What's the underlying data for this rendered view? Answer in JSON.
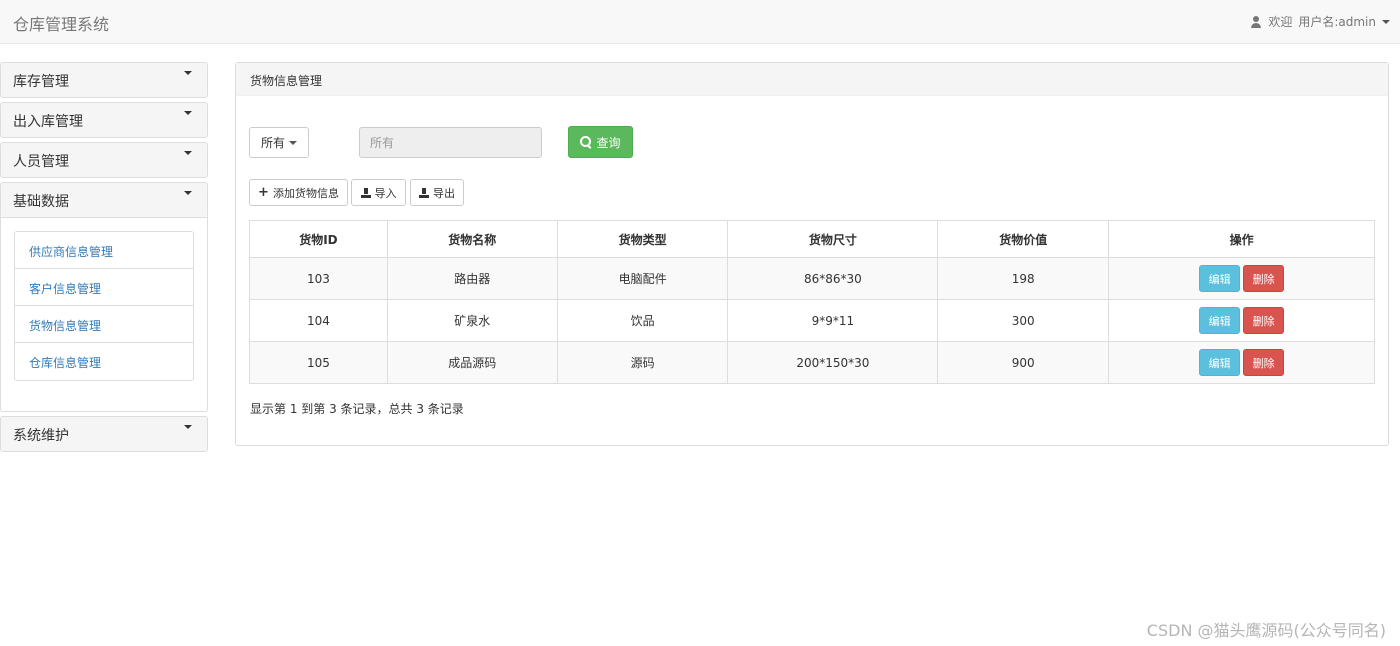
{
  "navbar": {
    "brand": "仓库管理系统",
    "welcome": "欢迎",
    "username": "用户名:admin"
  },
  "sidebar": {
    "menus": [
      {
        "label": "库存管理"
      },
      {
        "label": "出入库管理"
      },
      {
        "label": "人员管理"
      },
      {
        "label": "基础数据",
        "items": [
          "供应商信息管理",
          "客户信息管理",
          "货物信息管理",
          "仓库信息管理"
        ]
      },
      {
        "label": "系统维护"
      }
    ]
  },
  "panel": {
    "title": "货物信息管理",
    "filter_select": "所有",
    "search_placeholder": "所有",
    "query_label": "查询",
    "add_label": "添加货物信息",
    "import_label": "导入",
    "export_label": "导出"
  },
  "table": {
    "headers": [
      "货物ID",
      "货物名称",
      "货物类型",
      "货物尺寸",
      "货物价值",
      "操作"
    ],
    "rows": [
      {
        "id": "103",
        "name": "路由器",
        "type": "电脑配件",
        "size": "86*86*30",
        "value": "198"
      },
      {
        "id": "104",
        "name": "矿泉水",
        "type": "饮品",
        "size": "9*9*11",
        "value": "300"
      },
      {
        "id": "105",
        "name": "成品源码",
        "type": "源码",
        "size": "200*150*30",
        "value": "900"
      }
    ],
    "edit_label": "编辑",
    "delete_label": "删除"
  },
  "pagination": {
    "summary": "显示第 1 到第 3 条记录，总共 3 条记录"
  },
  "watermark": "CSDN @猫头鹰源码(公众号同名)"
}
